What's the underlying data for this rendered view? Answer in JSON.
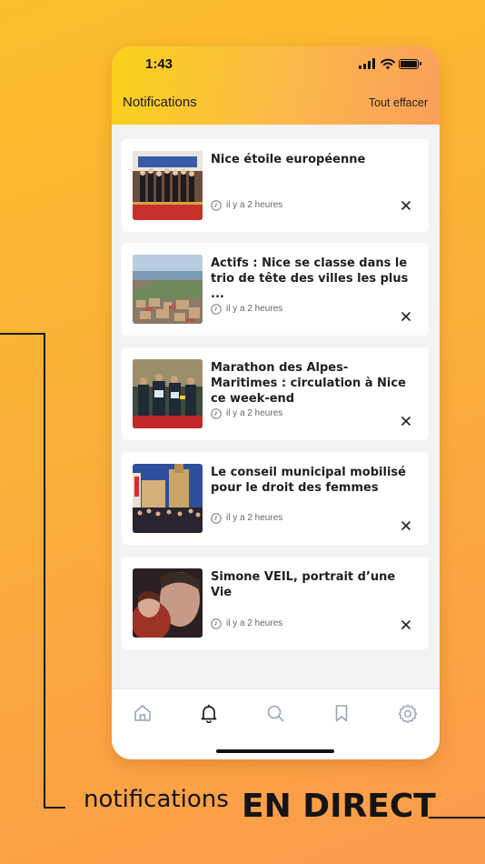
{
  "status_bar": {
    "time": "1:43"
  },
  "header": {
    "title": "Notifications",
    "clear_label": "Tout effacer"
  },
  "notifications": [
    {
      "title": "Nice étoile européenne",
      "time": "il y a 2 heures",
      "image": "ceremony-photo"
    },
    {
      "title": "Actifs : Nice se classe dans le trio de tête des villes les plus ...",
      "time": "il y a 2 heures",
      "image": "aerial-city-photo"
    },
    {
      "title": "Marathon des Alpes-Maritimes : circulation à Nice ce week-end",
      "time": "il y a 2 heures",
      "image": "runners-photo"
    },
    {
      "title": "Le conseil municipal mobilisé pour le droit des femmes",
      "time": "il y a 2 heures",
      "image": "crowd-square-photo"
    },
    {
      "title": "Simone VEIL, portrait d’une Vie",
      "time": "il y a 2 heures",
      "image": "portrait-photo"
    }
  ],
  "tabbar": {
    "items": [
      {
        "icon": "home-icon",
        "active": false
      },
      {
        "icon": "bell-icon",
        "active": true
      },
      {
        "icon": "search-icon",
        "active": false
      },
      {
        "icon": "bookmark-icon",
        "active": false
      },
      {
        "icon": "gear-icon",
        "active": false
      }
    ]
  },
  "promo": {
    "small": "notifications",
    "big": "EN DIRECT"
  },
  "colors": {
    "accent_start": "#fad11a",
    "accent_end": "#fb9f5b",
    "inactive_icon": "#9aa3b5",
    "active_icon": "#1a1a1a"
  }
}
